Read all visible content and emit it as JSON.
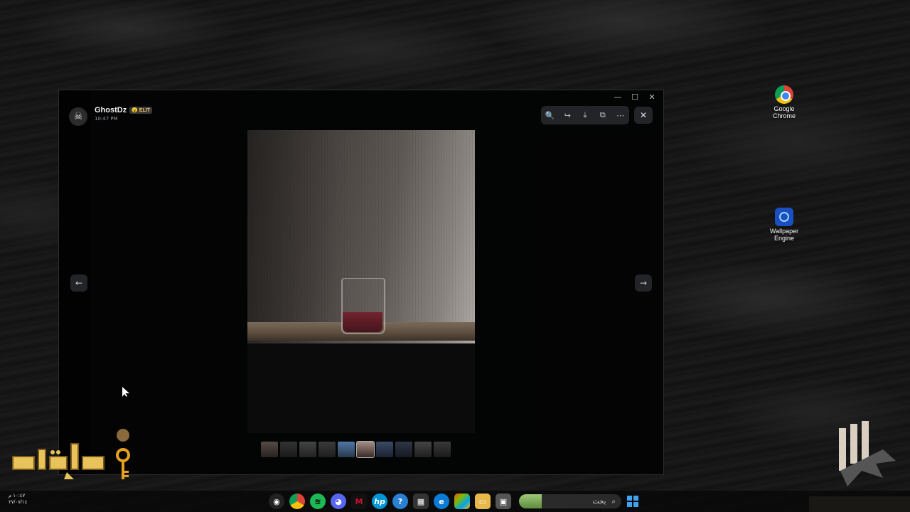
{
  "desktop": {
    "icons": [
      {
        "label": "Google Chrome",
        "icon": "chrome-icon"
      },
      {
        "label": "Wallpaper Engine",
        "icon": "wallpaper-engine-icon"
      }
    ]
  },
  "viewer": {
    "author_name": "GhostDz",
    "author_badge": "😮 ELIT",
    "timestamp": "10:47 PM",
    "toolbar": {
      "zoom_icon": "🔍",
      "forward_icon": "↪",
      "download_icon": "⤓",
      "open_external_icon": "⧉",
      "more_icon": "⋯"
    },
    "close_icon": "✕",
    "prev_icon": "←",
    "next_icon": "→",
    "thumbnail_count": 10
  },
  "window_controls": {
    "minimize": "—",
    "maximize": "☐",
    "close": "✕"
  },
  "taskbar": {
    "search_placeholder": "بحث",
    "search_icon": "⌕",
    "clock_time": "١٠:٤٧ م",
    "clock_date": "٢٧/٠٧/١٤"
  },
  "colors": {
    "accent": "#3fa4f0",
    "badge_text": "#f0c060",
    "logo_gold": "#e8c25a"
  }
}
